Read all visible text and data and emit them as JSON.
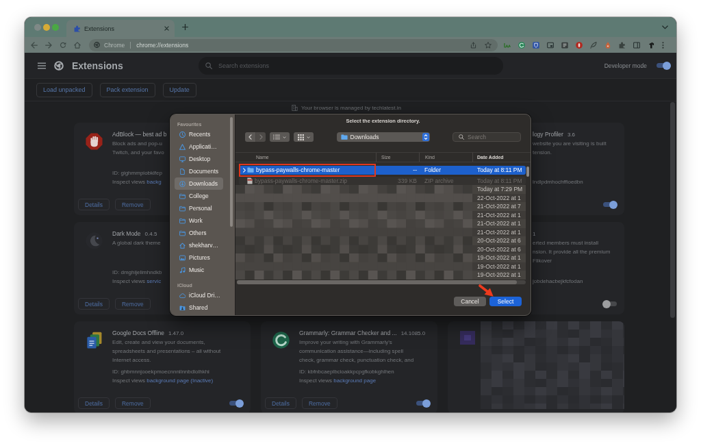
{
  "browser": {
    "tabs": [
      {
        "title": "Extensions",
        "selected": true
      }
    ],
    "address_bar": {
      "site": "Chrome",
      "url": "chrome://extensions"
    }
  },
  "page": {
    "title": "Extensions",
    "search": {
      "placeholder": "Search extensions"
    },
    "developer_mode": {
      "label": "Developer mode",
      "on": true
    },
    "actions": [
      "Load unpacked",
      "Pack extension",
      "Update"
    ],
    "managed_notice": "Your browser is managed by techlatest.in",
    "cards": [
      {
        "kind": "cut_right",
        "name": "AdBlock — best ad b",
        "description": "Block ads and pop-u\nTwitch, and your favo",
        "extension_id": "ID: gighmmpiobklfep",
        "inspect": {
          "label": "Inspect views",
          "link": "backg"
        },
        "buttons": [
          "Details",
          "Remove"
        ]
      },
      {
        "kind": "cut_left",
        "name": "logy Profiler",
        "version": "3.6",
        "description": "website you are visiting is built\ntension.",
        "extension_id": "indlpdmhochffioedbn",
        "enabled": true
      },
      {
        "kind": "cut_right",
        "name": "Dark Mode",
        "version": "0.4.5",
        "description": "A global dark theme",
        "extension_id": "ID: dmghijelimhndkb",
        "inspect": {
          "label": "Inspect views",
          "link": "servic"
        },
        "buttons": [
          "Details",
          "Remove"
        ]
      },
      {
        "kind": "cut_left",
        "version": "1",
        "description": "erted members must install\nnsion. It provide all the premium\nFlikover",
        "extension_id": "jobdehacbejkfcfodan",
        "enabled": false
      },
      {
        "kind": "full",
        "name": "Google Docs Offline",
        "version": "1.47.0",
        "description": "Edit, create and view your documents, spreadsheets and presentations – all without Internet access.",
        "extension_id": "ID: ghbmnnjooekpmoecnnnilnnbdlolhkhi",
        "inspect": {
          "label": "Inspect views",
          "link": "background page (Inactive)"
        },
        "buttons": [
          "Details",
          "Remove"
        ],
        "enabled": true
      },
      {
        "kind": "full",
        "name": "Grammarly: Grammar Checker and ...",
        "version": "14.1085.0",
        "description": "Improve your writing with Grammarly's communication assistance—including spell check, grammar check, punctuation check, and",
        "extension_id": "ID: kbfnbcaeplbcioakkpcpgfkobkghlhen",
        "inspect": {
          "label": "Inspect views",
          "link": "background page"
        },
        "buttons": [
          "Details",
          "Remove"
        ],
        "enabled": true
      },
      {
        "kind": "pixelated"
      }
    ]
  },
  "dialog": {
    "title": "Select the extension directory.",
    "sidebar": [
      {
        "heading": "Favourites",
        "items": [
          {
            "label": "Recents",
            "selected": false
          },
          {
            "label": "Applicati…",
            "selected": false
          },
          {
            "label": "Desktop",
            "selected": false
          },
          {
            "label": "Documents",
            "selected": false
          },
          {
            "label": "Downloads",
            "selected": true
          },
          {
            "label": "College",
            "selected": false
          },
          {
            "label": "Personal",
            "selected": false
          },
          {
            "label": "Work",
            "selected": false
          },
          {
            "label": "Others",
            "selected": false
          },
          {
            "label": "shekharv…",
            "selected": false
          },
          {
            "label": "Pictures",
            "selected": false
          },
          {
            "label": "Music",
            "selected": false
          }
        ]
      },
      {
        "heading": "iCloud",
        "items": [
          {
            "label": "iCloud Dri…",
            "selected": false
          },
          {
            "label": "Shared",
            "selected": false
          }
        ]
      }
    ],
    "navigation": [
      {
        "kind": "back",
        "disabled": false
      },
      {
        "kind": "forward",
        "disabled": true
      }
    ],
    "location": "Downloads",
    "search": {
      "placeholder": "Search"
    },
    "columns": [
      {
        "label": "Name",
        "selected": false
      },
      {
        "label": "Size",
        "selected": false
      },
      {
        "label": "Kind",
        "selected": false
      },
      {
        "label": "Date Added",
        "selected": true
      }
    ],
    "rows": [
      {
        "kind": "folder",
        "name": "bypass-paywalls-chrome-master",
        "size": "--",
        "file_kind": "Folder",
        "date_added": "Today at 8:11 PM",
        "selected": true,
        "disabled": false,
        "highlighted": true
      },
      {
        "kind": "zip",
        "name": "bypass-paywalls-chrome-master.zip",
        "size": "339 KB",
        "file_kind": "ZIP archive",
        "date_added": "Today at 8:11 PM",
        "selected": false,
        "disabled": true,
        "highlighted": false
      },
      {
        "kind": "pixelated",
        "date_added": "Today at 7:29 PM",
        "selected": false,
        "disabled": false,
        "highlighted": false
      },
      {
        "kind": "pixelated",
        "date_added": "22-Oct-2022 at 1",
        "selected": false,
        "disabled": false,
        "highlighted": false
      },
      {
        "kind": "pixelated",
        "date_added": "21-Oct-2022 at 7",
        "selected": false,
        "disabled": false,
        "highlighted": false
      },
      {
        "kind": "pixelated",
        "date_added": "21-Oct-2022 at 1",
        "selected": false,
        "disabled": false,
        "highlighted": false
      },
      {
        "kind": "pixelated",
        "date_added": "21-Oct-2022 at 1",
        "selected": false,
        "disabled": false,
        "highlighted": false
      },
      {
        "kind": "pixelated",
        "date_added": "21-Oct-2022 at 1",
        "selected": false,
        "disabled": false,
        "highlighted": false
      },
      {
        "kind": "pixelated",
        "date_added": "20-Oct-2022 at 6",
        "selected": false,
        "disabled": false,
        "highlighted": false
      },
      {
        "kind": "pixelated",
        "date_added": "20-Oct-2022 at 6",
        "selected": false,
        "disabled": false,
        "highlighted": false
      },
      {
        "kind": "pixelated",
        "date_added": "19-Oct-2022 at 1",
        "selected": false,
        "disabled": false,
        "highlighted": false
      },
      {
        "kind": "pixelated",
        "date_added": "19-Oct-2022 at 1",
        "selected": false,
        "disabled": false,
        "highlighted": false
      },
      {
        "kind": "pixelated",
        "date_added": "19-Oct-2022 at 1",
        "selected": false,
        "disabled": false,
        "highlighted": false
      }
    ],
    "buttons": [
      {
        "label": "Cancel",
        "kind": "secondary",
        "pointed_at": false
      },
      {
        "label": "Select",
        "kind": "primary",
        "pointed_at": true
      }
    ]
  }
}
